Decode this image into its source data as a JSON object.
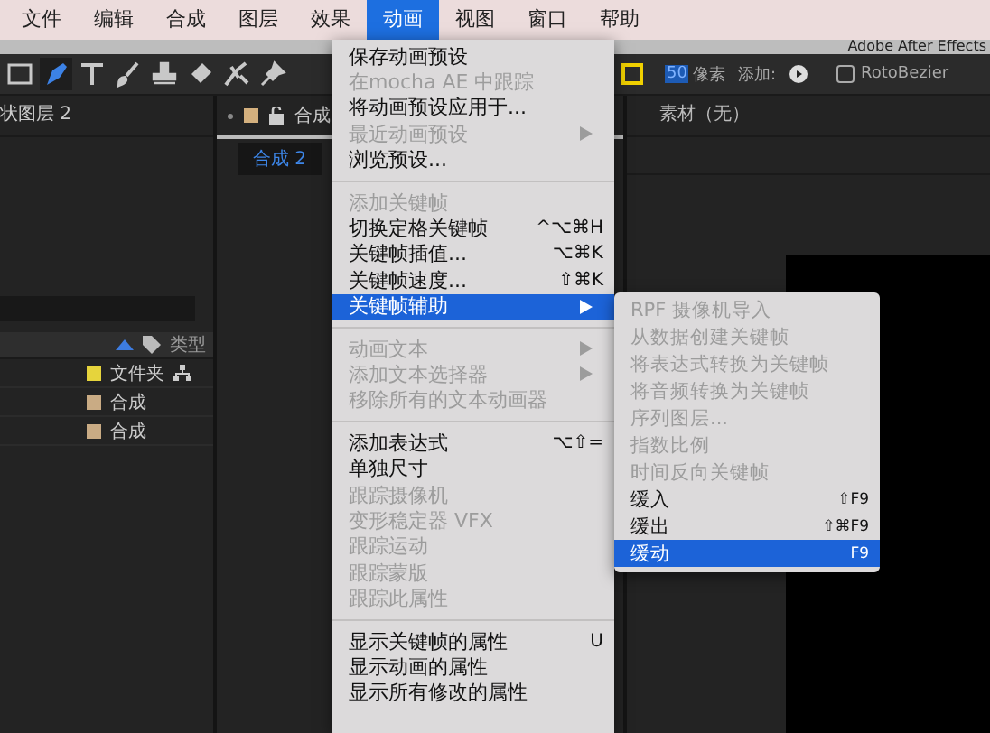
{
  "menubar": {
    "items": [
      {
        "label": "文件",
        "selected": false
      },
      {
        "label": "编辑",
        "selected": false
      },
      {
        "label": "合成",
        "selected": false
      },
      {
        "label": "图层",
        "selected": false
      },
      {
        "label": "效果",
        "selected": false
      },
      {
        "label": "动画",
        "selected": true
      },
      {
        "label": "视图",
        "selected": false
      },
      {
        "label": "窗口",
        "selected": false
      },
      {
        "label": "帮助",
        "selected": false
      }
    ]
  },
  "title_bar": {
    "title": "Adobe After Effects"
  },
  "toolbar": {
    "tools": [
      {
        "kind": "rectangle",
        "selected": false
      },
      {
        "kind": "pen",
        "selected": true
      },
      {
        "kind": "text",
        "selected": false
      },
      {
        "kind": "brush",
        "selected": false
      },
      {
        "kind": "stamp",
        "selected": false
      },
      {
        "kind": "eraser",
        "selected": false
      },
      {
        "kind": "roto",
        "selected": false
      },
      {
        "kind": "pin",
        "selected": false
      }
    ],
    "size_value": "50",
    "size_unit": "像素",
    "add_label": "添加:",
    "rotobezier": {
      "label": "RotoBezier",
      "checked": false
    }
  },
  "project_panel": {
    "title": "状图层 2",
    "column": "类型",
    "rows": [
      {
        "type": "文件夹",
        "color": "#e6d43c"
      },
      {
        "type": "合成",
        "color": "#c9ab84"
      },
      {
        "type": "合成",
        "color": "#c9ab84"
      }
    ]
  },
  "comp_panel": {
    "tab": "合成",
    "subtab": "合成 2"
  },
  "footage_panel": {
    "title": "素材（无）"
  },
  "menu": {
    "groups": [
      [
        {
          "label": "保存动画预设",
          "disabled": false,
          "submenu": false,
          "selected": false
        },
        {
          "label": "在mocha AE 中跟踪",
          "disabled": true,
          "submenu": false,
          "selected": false
        },
        {
          "label": "将动画预设应用于...",
          "disabled": false,
          "submenu": false,
          "selected": false
        },
        {
          "label": "最近动画预设",
          "disabled": true,
          "submenu": true,
          "selected": false
        },
        {
          "label": "浏览预设...",
          "disabled": false,
          "submenu": false,
          "selected": false
        }
      ],
      [
        {
          "label": "添加关键帧",
          "disabled": true,
          "submenu": false,
          "selected": false
        },
        {
          "label": "切换定格关键帧",
          "shortcut": "^⌥⌘H",
          "disabled": false,
          "submenu": false,
          "selected": false
        },
        {
          "label": "关键帧插值...",
          "shortcut": "⌥⌘K",
          "disabled": false,
          "submenu": false,
          "selected": false
        },
        {
          "label": "关键帧速度...",
          "shortcut": "⇧⌘K",
          "disabled": false,
          "submenu": false,
          "selected": false
        },
        {
          "label": "关键帧辅助",
          "disabled": false,
          "submenu": true,
          "selected": true
        }
      ],
      [
        {
          "label": "动画文本",
          "disabled": true,
          "submenu": true,
          "selected": false
        },
        {
          "label": "添加文本选择器",
          "disabled": true,
          "submenu": true,
          "selected": false
        },
        {
          "label": "移除所有的文本动画器",
          "disabled": true,
          "submenu": false,
          "selected": false
        }
      ],
      [
        {
          "label": "添加表达式",
          "shortcut": "⌥⇧=",
          "disabled": false,
          "submenu": false,
          "selected": false
        },
        {
          "label": "单独尺寸",
          "disabled": false,
          "submenu": false,
          "selected": false
        },
        {
          "label": "跟踪摄像机",
          "disabled": true,
          "submenu": false,
          "selected": false
        },
        {
          "label": "变形稳定器 VFX",
          "disabled": true,
          "submenu": false,
          "selected": false
        },
        {
          "label": "跟踪运动",
          "disabled": true,
          "submenu": false,
          "selected": false
        },
        {
          "label": "跟踪蒙版",
          "disabled": true,
          "submenu": false,
          "selected": false
        },
        {
          "label": "跟踪此属性",
          "disabled": true,
          "submenu": false,
          "selected": false
        }
      ],
      [
        {
          "label": "显示关键帧的属性",
          "shortcut": "U",
          "disabled": false,
          "submenu": false,
          "selected": false
        },
        {
          "label": "显示动画的属性",
          "disabled": false,
          "submenu": false,
          "selected": false
        },
        {
          "label": "显示所有修改的属性",
          "disabled": false,
          "submenu": false,
          "selected": false
        }
      ]
    ]
  },
  "submenu": {
    "items": [
      {
        "label": "RPF 摄像机导入",
        "disabled": true,
        "selected": false
      },
      {
        "label": "从数据创建关键帧",
        "disabled": true,
        "selected": false
      },
      {
        "label": "将表达式转换为关键帧",
        "disabled": true,
        "selected": false
      },
      {
        "label": "将音频转换为关键帧",
        "disabled": true,
        "selected": false
      },
      {
        "label": "序列图层...",
        "disabled": true,
        "selected": false
      },
      {
        "label": "指数比例",
        "disabled": true,
        "selected": false
      },
      {
        "label": "时间反向关键帧",
        "disabled": true,
        "selected": false
      },
      {
        "label": "缓入",
        "shortcut": "⇧F9",
        "disabled": false,
        "selected": false
      },
      {
        "label": "缓出",
        "shortcut": "⇧⌘F9",
        "disabled": false,
        "selected": false
      },
      {
        "label": "缓动",
        "shortcut": "F9",
        "disabled": false,
        "selected": true
      }
    ]
  }
}
